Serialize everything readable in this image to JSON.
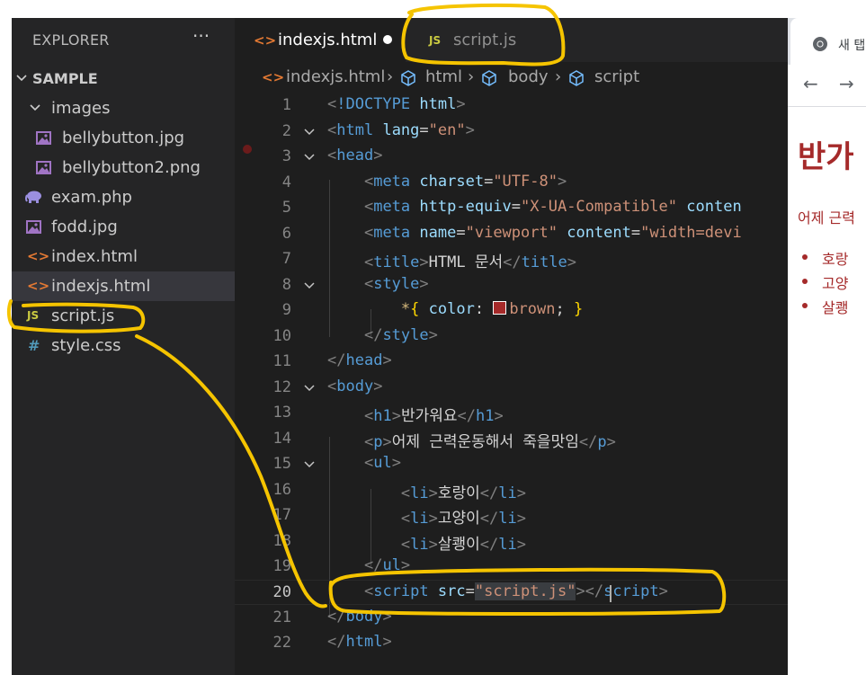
{
  "explorer": {
    "title": "EXPLORER",
    "more": "···",
    "root": "SAMPLE",
    "items": [
      {
        "label": "images",
        "type": "folder"
      },
      {
        "label": "bellybutton.jpg",
        "type": "image"
      },
      {
        "label": "bellybutton2.png",
        "type": "image"
      },
      {
        "label": "exam.php",
        "type": "php"
      },
      {
        "label": "fodd.jpg",
        "type": "image"
      },
      {
        "label": "index.html",
        "type": "html"
      },
      {
        "label": "indexjs.html",
        "type": "html"
      },
      {
        "label": "script.js",
        "type": "js"
      },
      {
        "label": "style.css",
        "type": "css"
      }
    ],
    "icons": {
      "html": "<>",
      "js": "JS",
      "css": "#"
    }
  },
  "tabs": [
    {
      "label": "indexjs.html",
      "icon": "<>",
      "modified": true
    },
    {
      "label": "script.js",
      "icon": "JS"
    }
  ],
  "breadcrumb": {
    "file": "indexjs.html",
    "items": [
      "html",
      "body",
      "script"
    ]
  },
  "code": {
    "current_line": 20,
    "lines": [
      {
        "n": "1"
      },
      {
        "n": "2"
      },
      {
        "n": "3"
      },
      {
        "n": "4"
      },
      {
        "n": "5"
      },
      {
        "n": "6"
      },
      {
        "n": "7"
      },
      {
        "n": "8"
      },
      {
        "n": "9"
      },
      {
        "n": "10"
      },
      {
        "n": "11"
      },
      {
        "n": "12"
      },
      {
        "n": "13"
      },
      {
        "n": "14"
      },
      {
        "n": "15"
      },
      {
        "n": "16"
      },
      {
        "n": "17"
      },
      {
        "n": "18"
      },
      {
        "n": "19"
      },
      {
        "n": "20"
      },
      {
        "n": "21"
      },
      {
        "n": "22"
      }
    ],
    "doctype": "!DOCTYPE",
    "tags": {
      "html": "html",
      "head": "head",
      "meta": "meta",
      "title": "title",
      "style": "style",
      "body": "body",
      "h1": "h1",
      "p": "p",
      "ul": "ul",
      "li": "li",
      "script": "script"
    },
    "attrs": {
      "lang": "lang",
      "charset": "charset",
      "http_equiv": "http-equiv",
      "content": "content",
      "name": "name",
      "src": "src"
    },
    "values": {
      "en": "\"en\"",
      "utf8": "\"UTF-8\"",
      "xua": "\"X-UA-Compatible\"",
      "viewport": "\"viewport\"",
      "width": "\"width=devi",
      "script_src": "\"script.js\""
    },
    "line5_trunc": "conten",
    "title_text": "HTML 문서",
    "css_selector": "*",
    "css_prop": "color",
    "css_value": "brown",
    "h1_text": "반가워요",
    "p_text": "어제 근력운동해서 죽을맛임",
    "li_texts": [
      "호랑이",
      "고양이",
      "살쾡이"
    ]
  },
  "browser": {
    "tab_title": "새 탭",
    "back": "←",
    "forward": "→",
    "h1": "반가",
    "p": "어제 근력",
    "items": [
      "호랑",
      "고양",
      "살쾡"
    ],
    "text_color": "#a52a2a"
  },
  "colors": {
    "annotation": "#f5c400",
    "accent_tag": "#569cd6",
    "accent_string": "#ce9178"
  }
}
